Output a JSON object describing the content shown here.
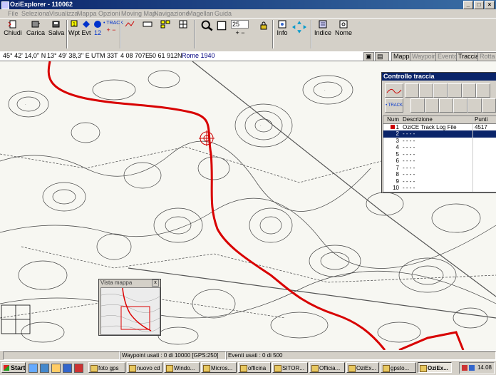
{
  "window": {
    "title": "OziExplorer - 110062"
  },
  "menu": [
    "File",
    "Seleziona",
    "Visualizza",
    "Mappa",
    "Opzioni",
    "Moving Map",
    "Navigazione",
    "Magellan",
    "Guida"
  ],
  "toolbar": {
    "close": "Chiudi",
    "load": "Carica",
    "save": "Salva",
    "wpt": "Wpt",
    "evt": "Evt",
    "track_label": "• TRACK",
    "zoom_value": "25",
    "info": "Info",
    "index": "Indice",
    "name": "Nome",
    "nums": [
      "1",
      "12"
    ]
  },
  "coords": {
    "lat": "45° 42' 14,0'' N",
    "lon": "13° 49' 38,3'' E",
    "utm": "UTM  33T",
    "east": "4 08 707E",
    "north": "50 61 912N",
    "datum": "Rome 1940",
    "tabs": [
      "Mappa",
      "Waypoint",
      "Evento",
      "Traccia",
      "Rotta"
    ]
  },
  "track_panel": {
    "title": "Controllo traccia",
    "track_btn": "• TRACK",
    "headers": [
      "Num",
      "Descrizione",
      "Punti"
    ],
    "rows": [
      {
        "num": "1",
        "desc": "OziCE Track Log File",
        "points": "4517"
      },
      {
        "num": "2",
        "desc": "- - - -",
        "points": ""
      },
      {
        "num": "3",
        "desc": "- - - -",
        "points": ""
      },
      {
        "num": "4",
        "desc": "- - - -",
        "points": ""
      },
      {
        "num": "5",
        "desc": "- - - -",
        "points": ""
      },
      {
        "num": "6",
        "desc": "- - - -",
        "points": ""
      },
      {
        "num": "7",
        "desc": "- - - -",
        "points": ""
      },
      {
        "num": "8",
        "desc": "- - - -",
        "points": ""
      },
      {
        "num": "9",
        "desc": "- - - -",
        "points": ""
      },
      {
        "num": "10",
        "desc": "- - - -",
        "points": ""
      }
    ],
    "track_color": "#cc0000"
  },
  "overview": {
    "title": "Vista mappa",
    "close": "x"
  },
  "status": {
    "waypoints": "Waypoint usati : 0 di 10000  [GPS:250]",
    "events": "Eventi usati : 0 di 500"
  },
  "taskbar": {
    "start": "Start",
    "tasks": [
      "foto gps",
      "nuovo cd",
      "Windo...",
      "Micros...",
      "officina",
      "SITOR...",
      "Officia...",
      "OziEx...",
      "gpsto...",
      "OziEx..."
    ],
    "clock": "14.08"
  }
}
